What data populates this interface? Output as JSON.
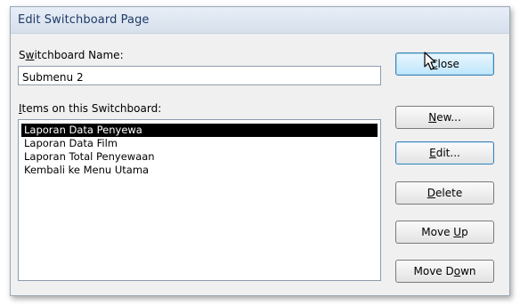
{
  "window": {
    "title": "Edit Switchboard Page"
  },
  "switchboard_name": {
    "label_pre": "S",
    "label_key": "w",
    "label_post": "itchboard Name:",
    "value": "Submenu 2"
  },
  "items": {
    "label_key": "I",
    "label_post": "tems on this Switchboard:",
    "list": [
      {
        "label": "Laporan Data Penyewa",
        "selected": true
      },
      {
        "label": "Laporan Data Film",
        "selected": false
      },
      {
        "label": "Laporan Total Penyewaan",
        "selected": false
      },
      {
        "label": "Kembali ke Menu Utama",
        "selected": false
      }
    ]
  },
  "buttons": {
    "close": {
      "pre": "",
      "key": "C",
      "post": "lose"
    },
    "new": {
      "pre": "",
      "key": "N",
      "post": "ew..."
    },
    "edit": {
      "pre": "",
      "key": "E",
      "post": "dit..."
    },
    "delete": {
      "pre": "",
      "key": "D",
      "post": "elete"
    },
    "move_up": {
      "pre": "Move ",
      "key": "U",
      "post": "p"
    },
    "move_down": {
      "pre": "Move D",
      "key": "o",
      "post": "wn"
    }
  },
  "icons": {
    "cursor": "mouse-pointer-icon"
  },
  "colors": {
    "selection_bg": "#000000",
    "title_text": "#1f3a66",
    "default_button_border": "#3c7fb1"
  }
}
